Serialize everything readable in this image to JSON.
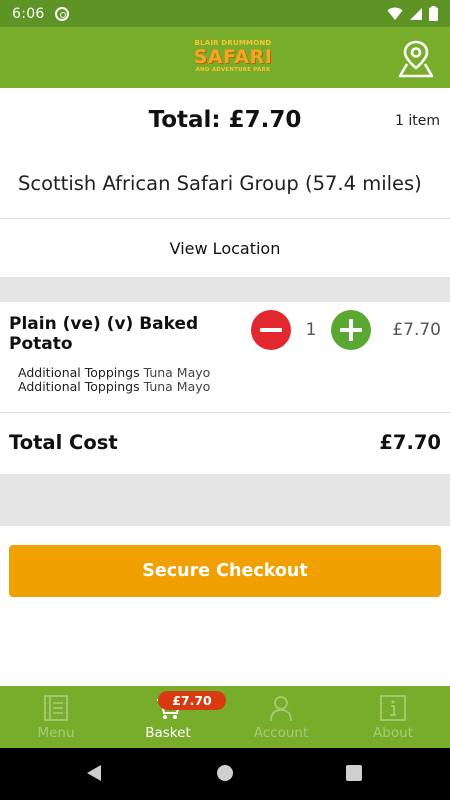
{
  "status_bar": {
    "time": "6:06",
    "icons": [
      "wifi-icon",
      "signal-icon",
      "battery-icon"
    ]
  },
  "app_bar": {
    "logo": {
      "line1": "BLAIR DRUMMOND",
      "line2": "SAFARI",
      "line3": "AND ADVENTURE PARK"
    },
    "location_icon": "map-pin-icon"
  },
  "basket": {
    "total_label": "Total: £7.70",
    "item_count": "1 item",
    "restaurant": "Scottish African Safari Group (57.4 miles)",
    "view_location": "View Location",
    "items": [
      {
        "name": "Plain (ve) (v) Baked Potato",
        "quantity": "1",
        "price": "£7.70",
        "modifiers": [
          {
            "label": "Additional Toppings",
            "value": "Tuna Mayo"
          },
          {
            "label": "Additional Toppings",
            "value": "Tuna Mayo"
          }
        ]
      }
    ],
    "total_cost_label": "Total Cost",
    "total_cost_value": "£7.70",
    "checkout_label": "Secure Checkout"
  },
  "bottom_nav": {
    "items": [
      {
        "label": "Menu",
        "icon": "menu-book-icon",
        "active": false
      },
      {
        "label": "Basket",
        "icon": "cart-icon",
        "active": true
      },
      {
        "label": "Account",
        "icon": "person-icon",
        "active": false
      },
      {
        "label": "About",
        "icon": "info-icon",
        "active": false
      }
    ],
    "badge": "£7.70"
  },
  "colors": {
    "header_green": "#78ad2b",
    "status_green": "#5e9425",
    "checkout_orange": "#f0a000",
    "minus_red": "#e0282e",
    "plus_green": "#5aa832",
    "badge_red": "#d83b12"
  }
}
